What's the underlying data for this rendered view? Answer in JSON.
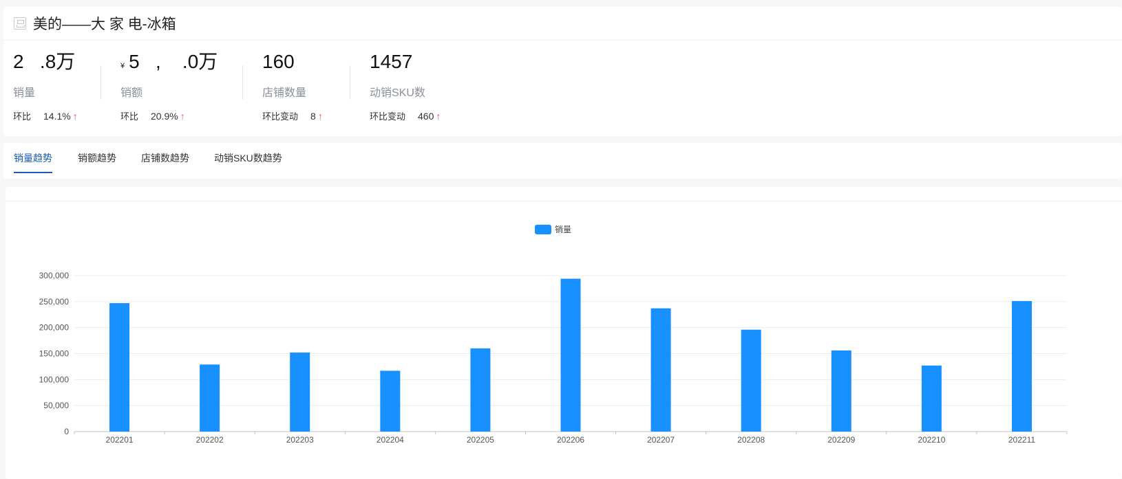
{
  "header": {
    "title": "美的——大 家 电-冰箱",
    "icon": "product-icon"
  },
  "kpis": [
    {
      "value": "2   .8万",
      "label": "销量",
      "change_label": "环比",
      "change_value": "14.1%",
      "arrow": "↑"
    },
    {
      "currency": "¥",
      "value": "5   ,    .0万",
      "label": "销额",
      "change_label": "环比",
      "change_value": "20.9%",
      "arrow": "↑"
    },
    {
      "value": "160",
      "label": "店铺数量",
      "change_label": "环比变动",
      "change_value": "8",
      "arrow": "↑"
    },
    {
      "value": "1457",
      "label": "动销SKU数",
      "change_label": "环比变动",
      "change_value": "460",
      "arrow": "↑"
    }
  ],
  "tabs": [
    {
      "label": "销量趋势",
      "active": true
    },
    {
      "label": "销额趋势",
      "active": false
    },
    {
      "label": "店铺数趋势",
      "active": false
    },
    {
      "label": "动销SKU数趋势",
      "active": false
    }
  ],
  "colors": {
    "bar": "#1890ff",
    "accent": "#1a5bb4",
    "up": "#f04b4b"
  },
  "chart_data": {
    "type": "bar",
    "categories": [
      "202201",
      "202202",
      "202203",
      "202204",
      "202205",
      "202206",
      "202207",
      "202208",
      "202209",
      "202210",
      "202211"
    ],
    "series": [
      {
        "name": "销量",
        "values": [
          247000,
          129000,
          152000,
          117000,
          160000,
          294000,
          237000,
          196000,
          156000,
          127000,
          251000
        ]
      }
    ],
    "ylim": [
      0,
      300000
    ],
    "yticks": [
      0,
      50000,
      100000,
      150000,
      200000,
      250000,
      300000
    ],
    "ytick_labels": [
      "0",
      "50,000",
      "100,000",
      "150,000",
      "200,000",
      "250,000",
      "300,000"
    ],
    "grid": true,
    "legend": "top-center"
  }
}
